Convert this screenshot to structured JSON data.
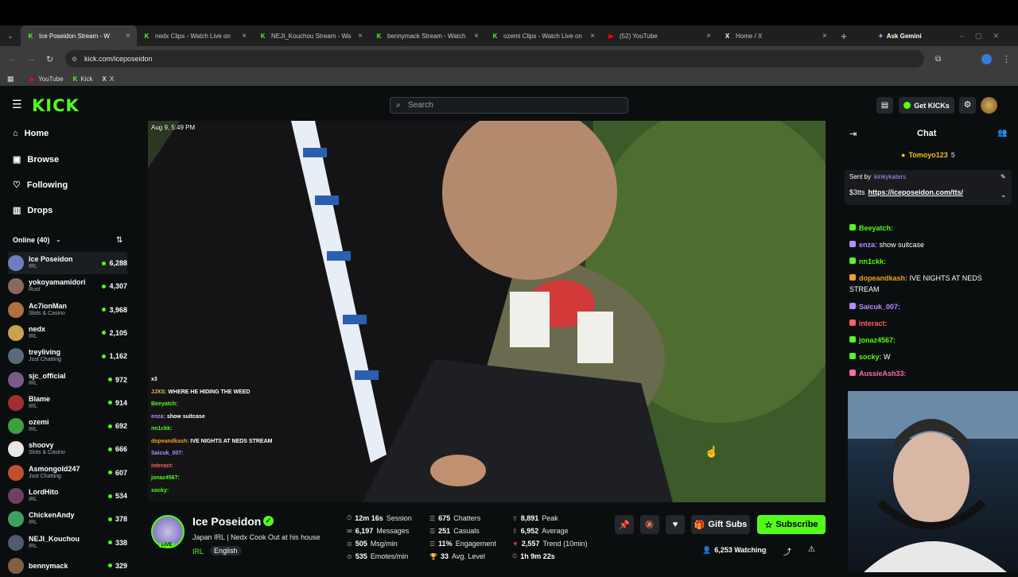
{
  "browser": {
    "tabs": [
      {
        "title": "Ice Poseidon Stream - W",
        "fav": "K",
        "favcolor": "#53fc18"
      },
      {
        "title": "nedx Clips - Watch Live on",
        "fav": "K",
        "favcolor": "#53fc18"
      },
      {
        "title": "NEJI_Kouchou Stream - Wa",
        "fav": "K",
        "favcolor": "#53fc18"
      },
      {
        "title": "bennymack Stream - Watch",
        "fav": "K",
        "favcolor": "#53fc18"
      },
      {
        "title": "ozemi Clips - Watch Live on",
        "fav": "K",
        "favcolor": "#53fc18"
      },
      {
        "title": "(52) YouTube",
        "fav": "▶",
        "favcolor": "#ff0000"
      },
      {
        "title": "Home / X",
        "fav": "X",
        "favcolor": "#ffffff"
      }
    ],
    "new_tab": "+",
    "gemini": "Ask Gemini",
    "url": "kick.com/iceposeidon",
    "bookmarks": [
      {
        "label": "YouTube"
      },
      {
        "label": "Kick"
      },
      {
        "label": "X"
      }
    ]
  },
  "header": {
    "logo": "KICK",
    "search_placeholder": "Search",
    "get_kicks": "Get KICKs"
  },
  "sidebar": {
    "nav": [
      {
        "label": "Home",
        "icon": "home-icon"
      },
      {
        "label": "Browse",
        "icon": "browse-icon"
      },
      {
        "label": "Following",
        "icon": "heart-icon"
      },
      {
        "label": "Drops",
        "icon": "drops-icon"
      }
    ],
    "online_label": "Online (40)",
    "channels": [
      {
        "name": "Ice Poseidon",
        "cat": "IRL",
        "viewers": "6,288",
        "color": "#6b7fbf"
      },
      {
        "name": "yokoyamamidori",
        "cat": "Rust",
        "viewers": "4,307",
        "color": "#8a6a5a"
      },
      {
        "name": "Ac7ionMan",
        "cat": "Slots & Casino",
        "viewers": "3,968",
        "color": "#b07040"
      },
      {
        "name": "nedx",
        "cat": "IRL",
        "viewers": "2,105",
        "color": "#c9a34a"
      },
      {
        "name": "treyliving",
        "cat": "Just Chatting",
        "viewers": "1,162",
        "color": "#5a6a7a"
      },
      {
        "name": "sjc_official",
        "cat": "IRL",
        "viewers": "972",
        "color": "#7a5a8a"
      },
      {
        "name": "Blame",
        "cat": "IRL",
        "viewers": "914",
        "color": "#a03030"
      },
      {
        "name": "ozemi",
        "cat": "IRL",
        "viewers": "692",
        "color": "#3aa040"
      },
      {
        "name": "shoovy",
        "cat": "Slots & Casino",
        "viewers": "666",
        "color": "#e8e8e8"
      },
      {
        "name": "Asmongold247",
        "cat": "Just Chatting",
        "viewers": "607",
        "color": "#c05030"
      },
      {
        "name": "LordHito",
        "cat": "IRL",
        "viewers": "534",
        "color": "#704060"
      },
      {
        "name": "ChickenAndy",
        "cat": "IRL",
        "viewers": "378",
        "color": "#40a060"
      },
      {
        "name": "NEJI_Kouchou",
        "cat": "IRL",
        "viewers": "338",
        "color": "#505a70"
      },
      {
        "name": "bennymack",
        "cat": "",
        "viewers": "329",
        "color": "#806040"
      }
    ]
  },
  "video": {
    "timestamp": "Aug 9, 5:49 PM",
    "overlay_chat": [
      {
        "u": "",
        "t": "x3",
        "c": "#e33"
      },
      {
        "u": "JJXS:",
        "t": "WHERE HE HIDING THE WEED",
        "c": "#e7c44c"
      },
      {
        "u": "Beeyatch:",
        "t": "",
        "c": "#53fc18"
      },
      {
        "u": "enza:",
        "t": "show suitcase",
        "c": "#b58cff"
      },
      {
        "u": "nn1ckk:",
        "t": "",
        "c": "#53fc18"
      },
      {
        "u": "dopeandkash:",
        "t": "IVE NIGHTS AT NEDS STREAM",
        "c": "#f0a020"
      },
      {
        "u": "Saicuk_007:",
        "t": "",
        "c": "#b58cff"
      },
      {
        "u": "interact:",
        "t": "",
        "c": "#ff6060"
      },
      {
        "u": "jonaz4567:",
        "t": "",
        "c": "#53fc18"
      },
      {
        "u": "socky:",
        "t": "",
        "c": "#53fc18"
      }
    ]
  },
  "stream": {
    "name": "Ice Poseidon",
    "title": "Japan IRL | Nedx Cook Out at his house",
    "category": "IRL",
    "language": "English",
    "live": "LIVE",
    "stats": [
      {
        "v": "12m 16s",
        "l": "Session"
      },
      {
        "v": "675",
        "l": "Chatters"
      },
      {
        "v": "8,891",
        "l": "Peak"
      },
      {
        "v": "6,197",
        "l": "Messages"
      },
      {
        "v": "251",
        "l": "Casuals"
      },
      {
        "v": "6,952",
        "l": "Average"
      },
      {
        "v": "505",
        "l": "Msg/min"
      },
      {
        "v": "11%",
        "l": "Engagement"
      },
      {
        "v": "2,557",
        "l": "Trend (10min)"
      },
      {
        "v": "535",
        "l": "Emotes/min"
      },
      {
        "v": "33",
        "l": "Avg. Level"
      },
      {
        "v": "1h 9m 22s",
        "l": ""
      }
    ],
    "gift_subs": "Gift Subs",
    "subscribe": "Subscribe",
    "watching": "6,253 Watching"
  },
  "chat": {
    "title": "Chat",
    "pinned_user": "Tomoyo123",
    "pinned_count": "5",
    "sent_by_label": "Sent by",
    "sent_by_user": "kinkykaters",
    "tts_prefix": "$3tts",
    "tts_link": "https://iceposeidon.com/tts/",
    "messages": [
      {
        "u": "Beeyatch:",
        "t": "",
        "c": "#53fc18"
      },
      {
        "u": "enza:",
        "t": "show suitcase",
        "c": "#b58cff"
      },
      {
        "u": "nn1ckk:",
        "t": "",
        "c": "#53fc18"
      },
      {
        "u": "dopeandkash:",
        "t": "IVE NIGHTS AT NEDS STREAM",
        "c": "#f0a020"
      },
      {
        "u": "Saicuk_007:",
        "t": "",
        "c": "#b58cff"
      },
      {
        "u": "interact:",
        "t": "",
        "c": "#ff6060"
      },
      {
        "u": "jonaz4567:",
        "t": "",
        "c": "#53fc18"
      },
      {
        "u": "socky:",
        "t": "W",
        "c": "#53fc18"
      },
      {
        "u": "AussieAsh33:",
        "t": "",
        "c": "#ff69b4"
      }
    ]
  },
  "colors": {
    "accent": "#53fc18",
    "bg": "#0b0e0f",
    "panel": "#191b1f"
  }
}
